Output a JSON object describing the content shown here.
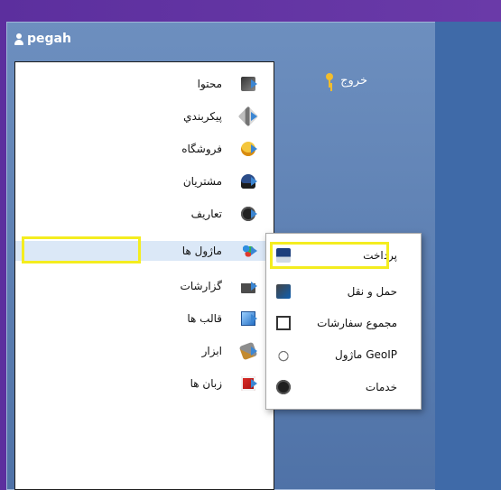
{
  "header": {
    "username": "pegah"
  },
  "actions": {
    "exit_label": "خروج"
  },
  "main_menu": {
    "items": [
      {
        "label": "محتوا",
        "icon": "content-icon"
      },
      {
        "label": "پيکربندي",
        "icon": "tools-icon"
      },
      {
        "label": "فروشگاه",
        "icon": "store-icon"
      },
      {
        "label": "مشتریان",
        "icon": "customers-icon"
      },
      {
        "label": "تعاریف",
        "icon": "definitions-icon"
      },
      {
        "label": "ماژول ها",
        "icon": "modules-icon"
      },
      {
        "label": "گزارشات",
        "icon": "reports-icon"
      },
      {
        "label": "قالب ها",
        "icon": "templates-icon"
      },
      {
        "label": "ابزار",
        "icon": "tools-wrench-icon"
      },
      {
        "label": "زبان ها",
        "icon": "languages-icon"
      }
    ]
  },
  "sub_menu": {
    "items": [
      {
        "label": "پرداخت",
        "icon": "payment-icon"
      },
      {
        "label": "حمل و نقل",
        "icon": "shipping-icon"
      },
      {
        "label": "مجموع سفارشات",
        "icon": "order-totals-icon"
      },
      {
        "label": "GeoIP ماژول",
        "icon": "geoip-icon"
      },
      {
        "label": "خدمات",
        "icon": "services-icon"
      }
    ]
  },
  "colors": {
    "background": "#6a3aa8",
    "panel": "#5f80b4",
    "highlight": "#f4ed1f",
    "menu_arrow": "#3b86d3"
  }
}
